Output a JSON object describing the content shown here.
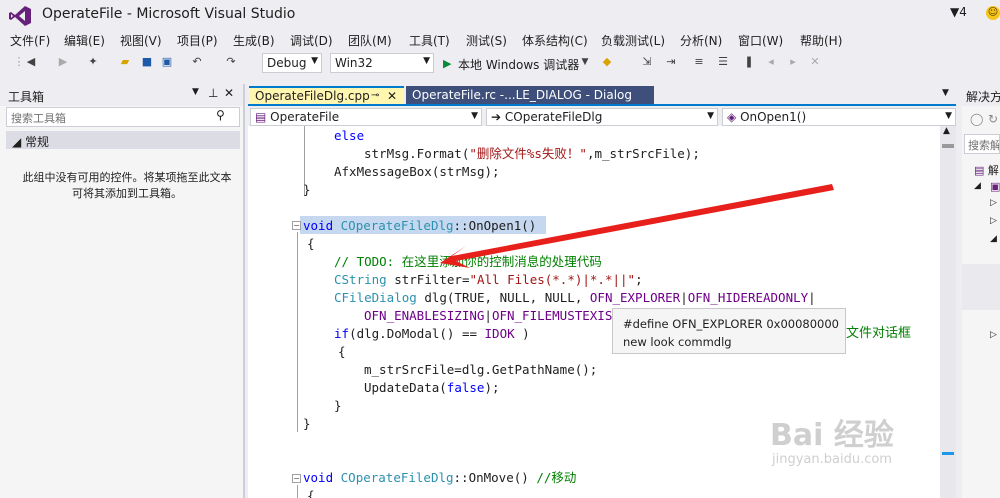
{
  "window": {
    "title": "OperateFile - Microsoft Visual Studio",
    "notif_count": "4",
    "smile": "☺"
  },
  "menu": [
    "文件(F)",
    "编辑(E)",
    "视图(V)",
    "项目(P)",
    "生成(B)",
    "调试(D)",
    "团队(M)",
    "工具(T)",
    "测试(S)",
    "体系结构(C)",
    "负载测试(L)",
    "分析(N)",
    "窗口(W)",
    "帮助(H)"
  ],
  "toolbar": {
    "config": "Debug",
    "platform": "Win32",
    "run_label": "本地 Windows 调试器"
  },
  "toolbox": {
    "title": "工具箱",
    "search_placeholder": "搜索工具箱",
    "group": "常规",
    "empty_message": "此组中没有可用的控件。将某项拖至此文本可将其添加到工具箱。"
  },
  "tabs": [
    {
      "label": "OperateFileDlg.cpp",
      "active": true
    },
    {
      "label": "OperateFile.rc -...LE_DIALOG - Dialog",
      "active": false
    }
  ],
  "navbar": {
    "scope": "OperateFile",
    "class": "COperateFileDlg",
    "method": "OnOpen1()"
  },
  "code": [
    {
      "id": "l1",
      "tokens": [
        [
          "kw",
          "else"
        ]
      ]
    },
    {
      "id": "l2",
      "tokens": [
        [
          "fn",
          "strMsg.Format("
        ],
        [
          "st",
          "\"删除文件%s失败！\""
        ],
        [
          "fn",
          ",m_strSrcFile);"
        ]
      ]
    },
    {
      "id": "l3",
      "tokens": [
        [
          "fn",
          "AfxMessageBox(strMsg);"
        ]
      ]
    },
    {
      "id": "l4",
      "tokens": [
        [
          "fn",
          "}"
        ]
      ]
    },
    {
      "id": "l5",
      "tokens": [
        [
          "kw",
          "void"
        ],
        [
          "fn",
          " "
        ],
        [
          "ty",
          "COperateFileDlg"
        ],
        [
          "fn",
          "::OnOpen1()"
        ]
      ]
    },
    {
      "id": "l6",
      "tokens": [
        [
          "fn",
          "{"
        ]
      ]
    },
    {
      "id": "l7",
      "tokens": [
        [
          "cm",
          "// TODO: 在这里添加你的控制消息的处理代码"
        ]
      ]
    },
    {
      "id": "l8",
      "tokens": [
        [
          "ty",
          "CString"
        ],
        [
          "fn",
          " strFilter="
        ],
        [
          "st",
          "\"All Files(*.*)|*.*||\""
        ],
        [
          "fn",
          ";"
        ]
      ]
    },
    {
      "id": "l9",
      "tokens": [
        [
          "ty",
          "CFileDialog"
        ],
        [
          "fn",
          " dlg(TRUE, NULL, NULL, "
        ],
        [
          "mc",
          "OFN_EXPLORER"
        ],
        [
          "fn",
          "|"
        ],
        [
          "mc",
          "OFN_HIDEREADONLY"
        ],
        [
          "fn",
          "|"
        ]
      ]
    },
    {
      "id": "l10",
      "tokens": [
        [
          "mc",
          "OFN_ENABLESIZING"
        ],
        [
          "fn",
          "|"
        ],
        [
          "mc",
          "OFN_FILEMUSTEXIST"
        ]
      ]
    },
    {
      "id": "l11",
      "tokens": [
        [
          "kw",
          "if"
        ],
        [
          "fn",
          "(dlg.DoModal() == "
        ],
        [
          "mc",
          "IDOK"
        ],
        [
          "fn",
          " )"
        ]
      ]
    },
    {
      "id": "l12",
      "tokens": [
        [
          "fn",
          "{"
        ]
      ]
    },
    {
      "id": "l13",
      "tokens": [
        [
          "fn",
          "m_strSrcFile=dlg.GetPathName();"
        ]
      ]
    },
    {
      "id": "l14",
      "tokens": [
        [
          "fn",
          "UpdateData("
        ],
        [
          "kw",
          "false"
        ],
        [
          "fn",
          ");"
        ]
      ]
    },
    {
      "id": "l15",
      "tokens": [
        [
          "fn",
          "}"
        ]
      ]
    },
    {
      "id": "l16",
      "tokens": [
        [
          "fn",
          "}"
        ]
      ]
    },
    {
      "id": "l17",
      "tokens": [
        [
          "kw",
          "void"
        ],
        [
          "fn",
          " "
        ],
        [
          "ty",
          "COperateFileDlg"
        ],
        [
          "fn",
          "::OnMove() "
        ],
        [
          "cm",
          "//移动"
        ]
      ]
    },
    {
      "id": "l18",
      "tokens": [
        [
          "fn",
          "{"
        ]
      ]
    }
  ],
  "code_tail": "文件对话框",
  "tooltip": {
    "line1": "#define OFN_EXPLORER 0x00080000",
    "line2": "new look commdlg"
  },
  "solution": {
    "title": "解决方",
    "search": "搜索解",
    "item": "解"
  },
  "watermark": {
    "main": "Bai 经验",
    "sub": "jingyan.baidu.com"
  },
  "colors": {
    "accent": "#007acc",
    "tab_active": "#fff6b0",
    "tab_inactive": "#3d4f7a",
    "arrow": "#e8201c"
  }
}
